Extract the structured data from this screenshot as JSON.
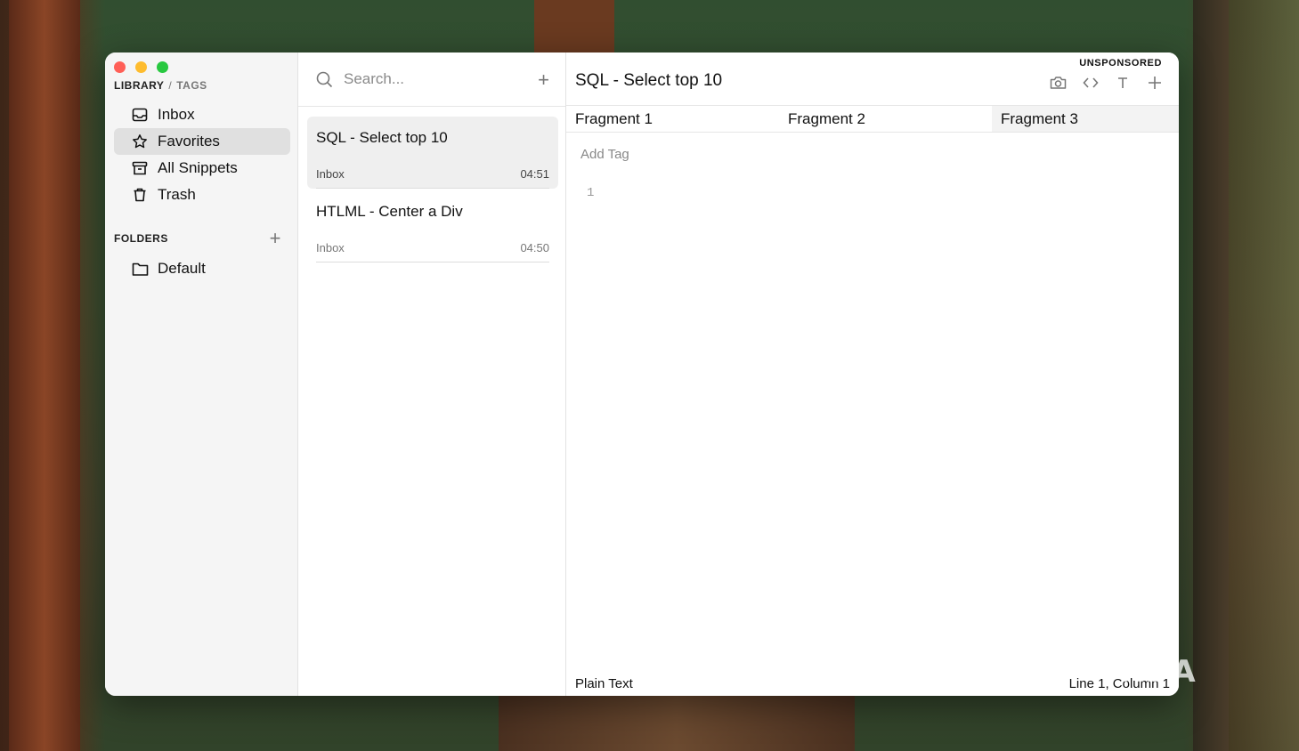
{
  "sidebar": {
    "library_label": "LIBRARY",
    "separator": "/",
    "tags_label": "TAGS",
    "items": [
      {
        "label": "Inbox",
        "icon": "inbox-icon"
      },
      {
        "label": "Favorites",
        "icon": "star-icon"
      },
      {
        "label": "All Snippets",
        "icon": "archive-icon"
      },
      {
        "label": "Trash",
        "icon": "trash-icon"
      }
    ],
    "folders_label": "FOLDERS",
    "folders": [
      {
        "label": "Default",
        "icon": "folder-icon"
      }
    ]
  },
  "list": {
    "search_placeholder": "Search...",
    "snippets": [
      {
        "title": "SQL - Select top 10",
        "folder": "Inbox",
        "time": "04:51"
      },
      {
        "title": "HTLML - Center a Div",
        "folder": "Inbox",
        "time": "04:50"
      }
    ]
  },
  "editor": {
    "unsponsored": "UNSPONSORED",
    "title": "SQL - Select top 10",
    "tabs": [
      "Fragment 1",
      "Fragment 2",
      "Fragment 3"
    ],
    "add_tag": "Add Tag",
    "line_number": "1",
    "language": "Plain Text",
    "cursor": "Line 1, Column 1"
  },
  "watermark": "XDA",
  "colors": {
    "close": "#ff5f57",
    "minimize": "#febc2e",
    "zoom": "#28c840"
  }
}
